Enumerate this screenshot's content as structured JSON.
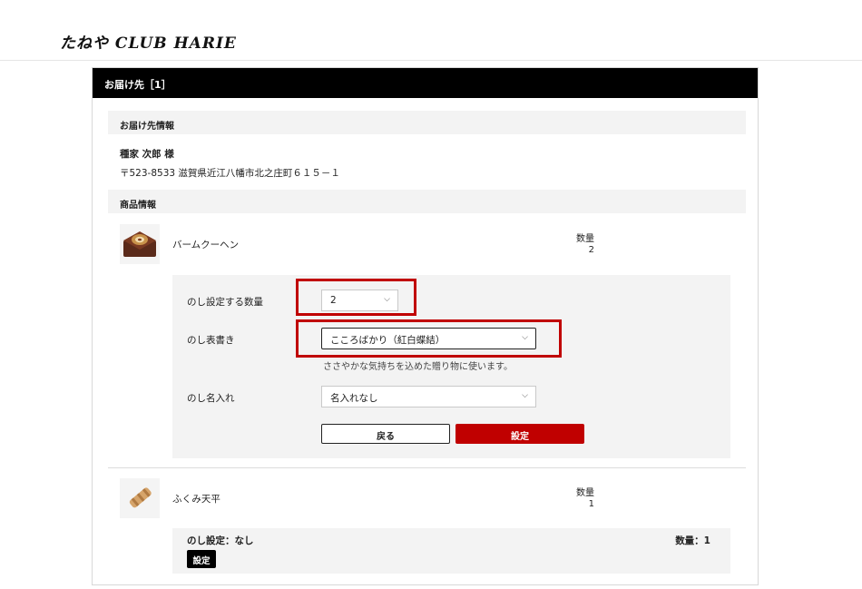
{
  "header": {
    "logo_text": "たねや CLUB HARIE"
  },
  "delivery": {
    "title": "お届け先［1］",
    "info_heading": "お届け先情報",
    "recipient_name": "種家 次郎 様",
    "recipient_address": "〒523-8533 滋賀県近江八幡市北之庄町６１５－１",
    "product_heading": "商品情報"
  },
  "products": [
    {
      "name": "バームクーヘン",
      "qty_label": "数量",
      "qty": "2",
      "noshi_form": {
        "qty_label": "のし設定する数量",
        "qty_value": "2",
        "type_label": "のし表書き",
        "type_value": "こころばかり（紅白蝶結）",
        "type_hint": "ささやかな気持ちを込めた贈り物に使います。",
        "name_label": "のし名入れ",
        "name_value": "名入れなし",
        "back_label": "戻る",
        "set_label": "設定"
      }
    },
    {
      "name": "ふくみ天平",
      "qty_label": "数量",
      "qty": "1",
      "noshi_summary": {
        "text": "のし設定：なし",
        "qty_text": "数量：1",
        "button_label": "設定"
      }
    }
  ],
  "icons": {
    "select_chevron": "chevron-down-icon"
  },
  "colors": {
    "accent_red": "#c00000",
    "header_black": "#000000",
    "panel_gray": "#f3f3f3"
  }
}
